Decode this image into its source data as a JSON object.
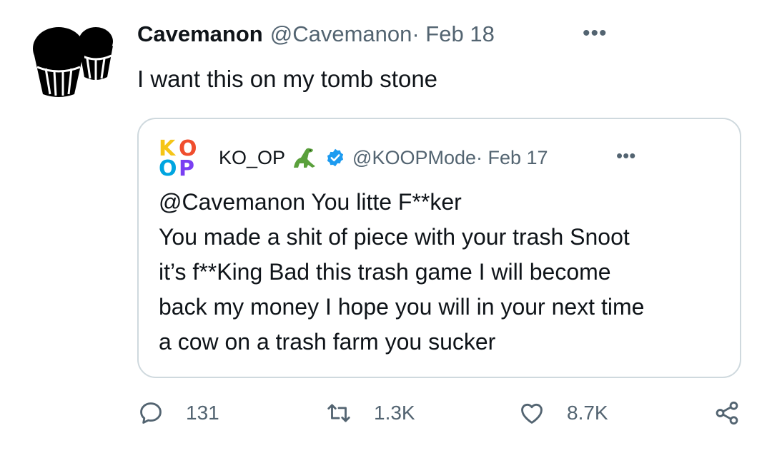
{
  "tweet": {
    "display_name": "Cavemanon",
    "handle": "@Cavemanon",
    "date": "· Feb 18",
    "more_icon": "ellipsis-icon",
    "text": "I want this on my tomb stone"
  },
  "quote": {
    "logo_letters": [
      "K",
      "O",
      "O",
      "P"
    ],
    "logo_colors": [
      "#f5c518",
      "#f04e2e",
      "#00a5e0",
      "#7a3ff2"
    ],
    "display_name": "KO_OP",
    "emoji_icon": "dinosaur-icon",
    "verified_icon": "verified-badge-icon",
    "handle": "@KOOPMode",
    "date": " · Feb 17",
    "more_icon": "ellipsis-icon",
    "lines": [
      "@Cavemanon You litte F**ker",
      "You made a shit of piece with your trash Snoot",
      "it’s f**King Bad this trash game I will become",
      "back my money I hope you will in your next time",
      "a cow on a trash farm you sucker"
    ]
  },
  "actions": {
    "reply_count": "131",
    "retweet_count": "1.3K",
    "like_count": "8.7K",
    "share_icon": "share-icon"
  }
}
